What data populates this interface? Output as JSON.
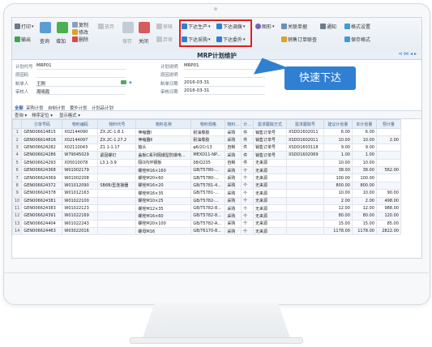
{
  "toolbar": {
    "print": "打印",
    "export": "输出",
    "query": "查询",
    "add": "增加",
    "copy": "复制",
    "modify": "修改",
    "delete": "删除",
    "abandon": "放弃",
    "save": "保存",
    "close": "关闭",
    "review": "审核",
    "unreview": "弃审",
    "push_production": "下达生产",
    "push_outsource": "下达委外",
    "push_purchase": "下达采购",
    "push_transfer": "下达调拨",
    "graph": "图形",
    "related": "关联单据",
    "related_order": "销售订单联查",
    "notify": "通知",
    "format_setting": "格式设置",
    "save_format": "保存格式"
  },
  "page": {
    "title": "MRP计划维护",
    "nav_icons": "⊲ ⋈ ◂ ▸"
  },
  "form": {
    "plan_code_label": "计划代号",
    "plan_code_value": "MRP01",
    "plan_desc_label": "原因码",
    "creator_label": "制单人",
    "creator_value": "王刚",
    "reviewer_label": "审核人",
    "reviewer_value": "周晓霞",
    "calc_desc_label": "计划说明",
    "calc_desc_value": "MRP01",
    "reason_label": "原因说明",
    "make_date_label": "制单日期",
    "make_date_value": "2016-03-31",
    "review_date_label": "审核日期",
    "review_date_value": "2016-03-31"
  },
  "callout": {
    "text": "快速下达"
  },
  "tabs": [
    "全部",
    "采购计划",
    "自制计划",
    "委外计划",
    "计划品计划"
  ],
  "subbar": {
    "query": "查询",
    "sort": "排序定位",
    "display": "显示格式"
  },
  "table": {
    "headers": [
      "",
      "订单号码",
      "物料编码",
      "物料代号",
      "物料名称",
      "物料规格",
      "物料...",
      "计...",
      "需求跟踪方式",
      "需求跟踪号",
      "建议计划量",
      "本计划量",
      "预计量"
    ],
    "rows": [
      [
        "1",
        "GEN006614815",
        "X02144090",
        "ZX.2C-1.8.1",
        "伸缩器Ⅰ",
        "耐油橡胶",
        "采购",
        "件",
        "销售订单号",
        "XSDD1602011",
        "6.00",
        "6.00",
        ""
      ],
      [
        "2",
        "GEN006614816",
        "X02144097",
        "ZX.2C-1.27.2",
        "伸缩器Ⅱ",
        "耐油橡胶",
        "采购",
        "件",
        "销售订单号",
        "XSDD1602011",
        "10.00",
        "10.00",
        "2.00"
      ],
      [
        "3",
        "GEN006624282",
        "X02110043",
        "Z1.1-1.17",
        "轴头",
        "φ6/2Cr13",
        "自制",
        "件",
        "销售订单号",
        "XSDD1603118",
        "9.00",
        "9.00",
        ""
      ],
      [
        "4",
        "GEN006624286",
        "W79045029",
        "紧固螺钉",
        "盖板C系列隔爆型防爆电...",
        "MEXD11-NP...",
        "采购",
        "件",
        "销售订单号",
        "XSDD1602069",
        "1.00",
        "1.00",
        ""
      ],
      [
        "5",
        "GEN006624293",
        "X05010078",
        "L3.1-3.9",
        "隔O内环钢板",
        "δ8/Q235",
        "自制",
        "件",
        "无来源",
        "",
        "10.00",
        "10.00",
        ""
      ],
      [
        "6",
        "GEN006624368",
        "W01002179",
        "",
        "螺栓M16×160",
        "GB/T5780-...",
        "采购",
        "个",
        "无来源",
        "",
        "38.00",
        "38.00",
        "562.00"
      ],
      [
        "7",
        "GEN006624369",
        "W01002208",
        "",
        "螺栓M20×60",
        "GB/T5780-...",
        "采购",
        "个",
        "无来源",
        "",
        "100.00",
        "100.00",
        ""
      ],
      [
        "8",
        "GEN006624372",
        "W01012090",
        "SB6B/型连接器",
        "螺栓M16×20",
        "GB/T5781-4...",
        "采购",
        "个",
        "无来源",
        "",
        "800.00",
        "800.00",
        ""
      ],
      [
        "9",
        "GEN006624378",
        "W01012163",
        "",
        "螺栓M16×35",
        "GB/T5781-...",
        "采购",
        "个",
        "无来源",
        "",
        "10.00",
        "10.00",
        "90.00"
      ],
      [
        "10",
        "GEN006624381",
        "W01022100",
        "",
        "螺栓M10×25",
        "GB/T5782-...",
        "采购",
        "个",
        "无来源",
        "",
        "2.00",
        "2.00",
        "498.00"
      ],
      [
        "11",
        "GEN006624383",
        "W01022123",
        "",
        "螺栓M12×35",
        "GB/T5782-8...",
        "采购",
        "个",
        "无来源",
        "",
        "12.00",
        "12.00",
        "988.00"
      ],
      [
        "12",
        "GEN006624391",
        "W01022169",
        "",
        "螺栓M16×60",
        "GB/T5782-8...",
        "采购",
        "个",
        "无来源",
        "",
        "80.00",
        "80.00",
        "120.00"
      ],
      [
        "13",
        "GEN006624404",
        "W01022243",
        "",
        "螺栓M20×100",
        "GB/T5782-A...",
        "采购",
        "个",
        "无来源",
        "",
        "15.00",
        "15.00",
        "85.00"
      ],
      [
        "14",
        "GEN006624463",
        "W03022016",
        "",
        "螺母M16",
        "GB/T6170-8...",
        "采购",
        "个",
        "无来源",
        "",
        "1178.00",
        "1178.00",
        "2822.00"
      ]
    ]
  },
  "colors": {
    "accent": "#2f7fd2",
    "highlight_border": "#e02020",
    "header_bg": "#e6eef7"
  }
}
